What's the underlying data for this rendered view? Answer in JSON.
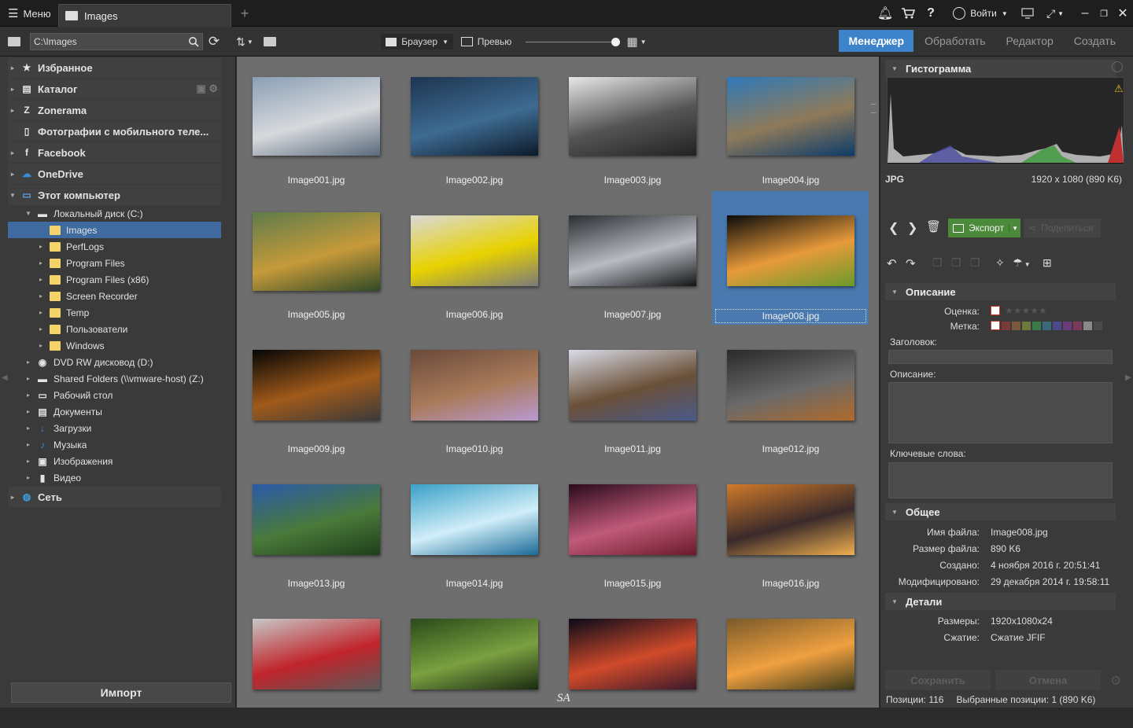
{
  "title_bar": {
    "menu_label": "Меню",
    "tab_label": "Images",
    "login_label": "Войти"
  },
  "toolbar": {
    "path_value": "C:\\Images",
    "view_mode_label": "Браузер",
    "preview_label": "Превью",
    "zoom_slider_value": 0.97
  },
  "mode_tabs": [
    "Менеджер",
    "Обработать",
    "Редактор",
    "Создать"
  ],
  "active_mode": "Менеджер",
  "sidebar": {
    "sections": [
      {
        "label": "Избранное",
        "icon": "star-icon"
      },
      {
        "label": "Каталог",
        "icon": "catalog-icon"
      },
      {
        "label": "Zonerama",
        "icon": "zonerama-icon"
      },
      {
        "label": "Фотографии с мобильного теле...",
        "icon": "phone-icon"
      },
      {
        "label": "Facebook",
        "icon": "facebook-icon"
      },
      {
        "label": "OneDrive",
        "icon": "onedrive-icon"
      },
      {
        "label": "Этот компьютер",
        "icon": "computer-icon"
      }
    ],
    "tree": [
      {
        "label": "Локальный диск (C:)",
        "icon": "drive-icon"
      },
      {
        "label": "Images",
        "icon": "folder-icon"
      },
      {
        "label": "PerfLogs",
        "icon": "folder-icon"
      },
      {
        "label": "Program Files",
        "icon": "folder-icon"
      },
      {
        "label": "Program Files (x86)",
        "icon": "folder-icon"
      },
      {
        "label": "Screen Recorder",
        "icon": "folder-icon"
      },
      {
        "label": "Temp",
        "icon": "folder-icon"
      },
      {
        "label": "Пользователи",
        "icon": "folder-icon"
      },
      {
        "label": "Windows",
        "icon": "folder-icon"
      },
      {
        "label": "DVD RW дисковод (D:)",
        "icon": "dvd-icon"
      },
      {
        "label": "Shared Folders (\\\\vmware-host) (Z:)",
        "icon": "network-drive-icon"
      },
      {
        "label": "Рабочий стол",
        "icon": "desktop-icon"
      },
      {
        "label": "Документы",
        "icon": "documents-icon"
      },
      {
        "label": "Загрузки",
        "icon": "downloads-icon"
      },
      {
        "label": "Музыка",
        "icon": "music-icon"
      },
      {
        "label": "Изображения",
        "icon": "pictures-icon"
      },
      {
        "label": "Видео",
        "icon": "video-icon"
      }
    ],
    "network_label": "Сеть",
    "import_label": "Импорт"
  },
  "thumbnails": [
    {
      "name": "Image001.jpg",
      "colors": [
        "#8a9fb5",
        "#d7d9dd",
        "#5a6a7c"
      ]
    },
    {
      "name": "Image002.jpg",
      "colors": [
        "#1d3550",
        "#3e6b92",
        "#0c1a2a"
      ]
    },
    {
      "name": "Image003.jpg",
      "colors": [
        "#e8e8e8",
        "#555555",
        "#222222"
      ]
    },
    {
      "name": "Image004.jpg",
      "colors": [
        "#2f79b8",
        "#8e7a5a",
        "#0d3c6a"
      ]
    },
    {
      "name": "Image005.jpg",
      "colors": [
        "#5e7c4a",
        "#c69a3a",
        "#2f4a26"
      ]
    },
    {
      "name": "Image006.jpg",
      "colors": [
        "#d9d9d9",
        "#e8d200",
        "#7a7a7a"
      ]
    },
    {
      "name": "Image007.jpg",
      "colors": [
        "#2a2e33",
        "#b8bcc2",
        "#121416"
      ]
    },
    {
      "name": "Image008.jpg",
      "colors": [
        "#0a0a0a",
        "#e79a3a",
        "#6a9a2a"
      ]
    },
    {
      "name": "Image009.jpg",
      "colors": [
        "#050505",
        "#a05a1a",
        "#3a3a3a"
      ]
    },
    {
      "name": "Image010.jpg",
      "colors": [
        "#6a4a3a",
        "#a87a5a",
        "#b99ad0"
      ]
    },
    {
      "name": "Image011.jpg",
      "colors": [
        "#d9dce8",
        "#6a5038",
        "#4a5a8a"
      ]
    },
    {
      "name": "Image012.jpg",
      "colors": [
        "#2a2a2a",
        "#6a6a6a",
        "#b06a2a"
      ]
    },
    {
      "name": "Image013.jpg",
      "colors": [
        "#2a5aa8",
        "#4a7a3a",
        "#1e3e1a"
      ]
    },
    {
      "name": "Image014.jpg",
      "colors": [
        "#3aa0c8",
        "#d0eef8",
        "#1a6a98"
      ]
    },
    {
      "name": "Image015.jpg",
      "colors": [
        "#2a0a1a",
        "#c05a7a",
        "#6a1a2a"
      ]
    },
    {
      "name": "Image016.jpg",
      "colors": [
        "#d07a2a",
        "#3a2a2a",
        "#f0b050"
      ]
    },
    {
      "name": "",
      "colors": [
        "#c8c8c8",
        "#c0242a",
        "#5a5a5a"
      ]
    },
    {
      "name": "",
      "colors": [
        "#2a4a1a",
        "#7aa040",
        "#1a2a12"
      ]
    },
    {
      "name": "",
      "colors": [
        "#0a0a1a",
        "#d04a2a",
        "#3a1a2a"
      ]
    },
    {
      "name": "",
      "colors": [
        "#7a5a2a",
        "#f0a040",
        "#3a3a1a"
      ]
    }
  ],
  "selected_thumbnail": "Image008.jpg",
  "watermark": "SA",
  "right_panel": {
    "histogram_title": "Гистограмма",
    "format": "JPG",
    "dimensions": "1920 x 1080 (890 K6)",
    "export_label": "Экспорт",
    "share_label": "Поделиться",
    "description_section": "Описание",
    "rating_label": "Оценка:",
    "tag_label": "Метка:",
    "heading_label": "Заголовок:",
    "description_label": "Описание:",
    "keywords_label": "Ключевые слова:",
    "general_section": "Общее",
    "general": [
      {
        "key": "Имя файла:",
        "value": "Image008.jpg"
      },
      {
        "key": "Размер файла:",
        "value": "890 K6"
      },
      {
        "key": "Создано:",
        "value": "4 ноября 2016 г. 20:51:41"
      },
      {
        "key": "Модифицировано:",
        "value": "29 декабря 2014 г. 19:58:11"
      }
    ],
    "details_section": "Детали",
    "details": [
      {
        "key": "Размеры:",
        "value": "1920x1080x24"
      },
      {
        "key": "Сжатие:",
        "value": "Сжатие JFIF"
      }
    ],
    "save_label": "Сохранить",
    "cancel_label": "Отмена",
    "tag_colors": [
      "#7a3a3a",
      "#7a5a3a",
      "#6a7a3a",
      "#3a7a4a",
      "#3a6a7a",
      "#4a4a8a",
      "#6a3a7a",
      "#7a3a5a",
      "#8a8a8a",
      "#4a4a4a"
    ]
  },
  "status": {
    "positions": "Позиции: 116",
    "selected": "Выбранные позиции: 1 (890 K6)"
  },
  "colors": {
    "accent": "#3d83c9",
    "export_green": "#4a8a3a",
    "folder_yellow": "#f3d36a",
    "selection_blue": "#4a79b0"
  }
}
